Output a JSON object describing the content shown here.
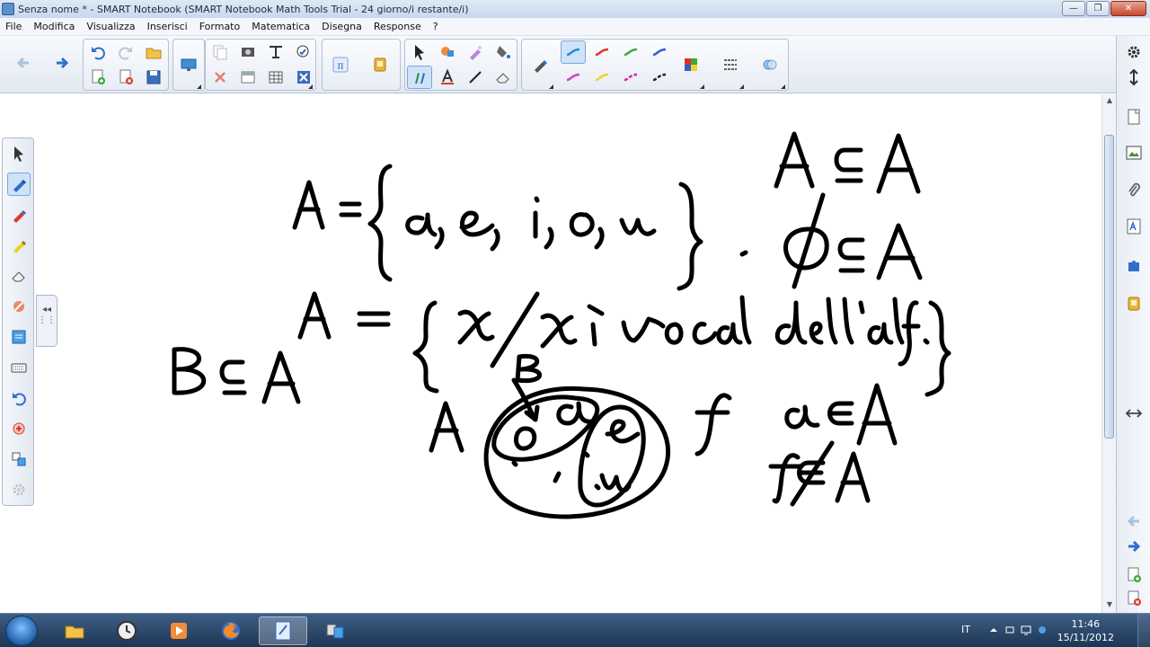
{
  "window": {
    "title": "Senza nome * - SMART Notebook (SMART Notebook Math Tools Trial - 24 giorno/i restante/i)",
    "minimize_label": "—",
    "maximize_label": "❐",
    "close_label": "✕"
  },
  "menu": {
    "items": [
      "File",
      "Modifica",
      "Visualizza",
      "Inserisci",
      "Formato",
      "Matematica",
      "Disegna",
      "Response",
      "?"
    ]
  },
  "toolbar": {
    "math_icon": "π",
    "pen_colors": [
      "#1f8fd8",
      "#e0302c",
      "#3ea83a",
      "#2b5fd0",
      "#d93bd0",
      "#f0d62a",
      "#e01fa6",
      "#222222"
    ]
  },
  "canvas": {
    "ink_color": "#000000",
    "handwriting": "A = {a, e, i, o, u} ; A ⊆ A ; ∅ ⊆ A ; A = {x / x è vocale dell'alf.} ; B ⊆ A ; a ∈ A ; f ∉ A"
  },
  "collapse_tab": {
    "label": "◂◂"
  },
  "taskbar": {
    "language": "IT",
    "time": "11:46",
    "date": "15/11/2012"
  },
  "colors": {
    "title_bar": "#c9d8ec",
    "toolbar_bg": "#e3e9f2",
    "taskbar_bg": "#1d3553",
    "active_tool": "#cfe2f8"
  }
}
